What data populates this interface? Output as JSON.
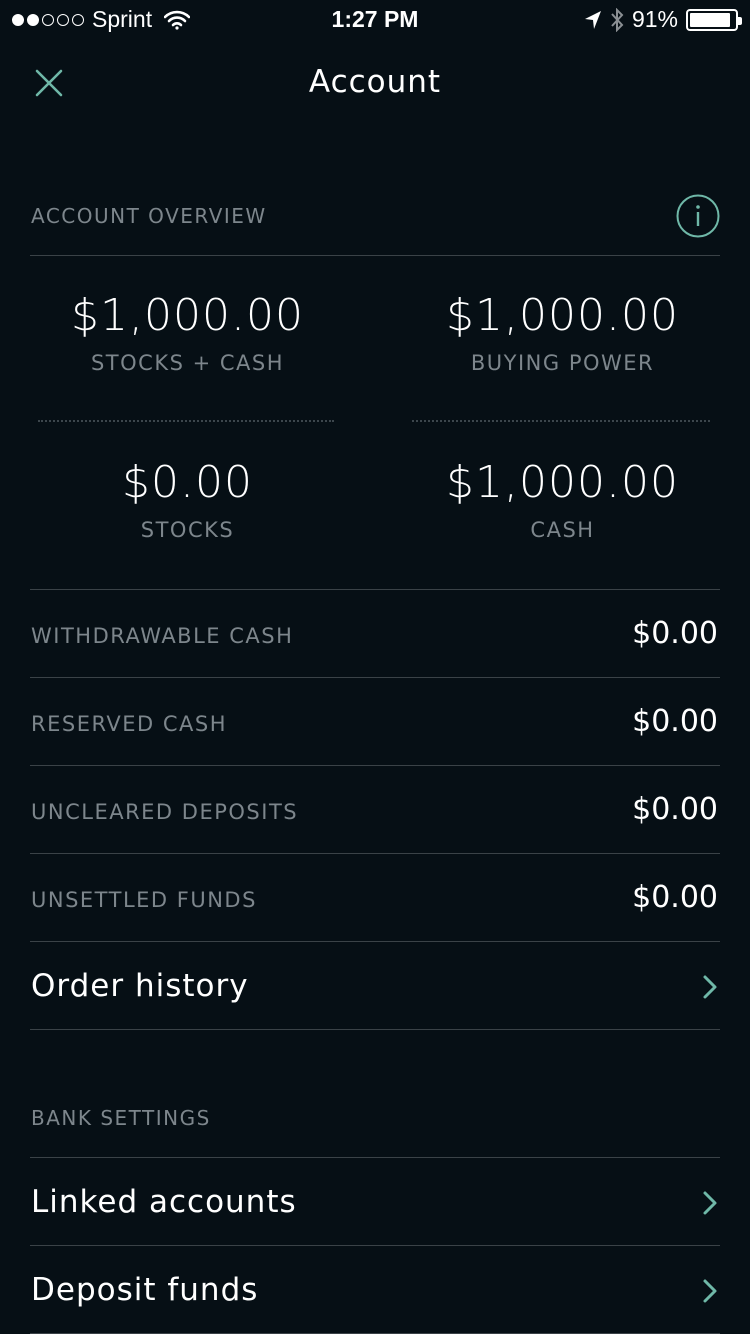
{
  "status_bar": {
    "carrier": "Sprint",
    "time": "1:27 PM",
    "battery": "91%",
    "battery_level": 0.91,
    "signal_bars_filled": 2,
    "signal_bars_total": 5
  },
  "nav": {
    "title": "Account",
    "close_icon": "close-icon"
  },
  "overview": {
    "header": "ACCOUNT OVERVIEW",
    "info_icon": "info-icon",
    "metrics": [
      {
        "value": "$1,000.00",
        "label": "STOCKS + CASH"
      },
      {
        "value": "$1,000.00",
        "label": "BUYING POWER"
      },
      {
        "value": "$0.00",
        "label": "STOCKS"
      },
      {
        "value": "$1,000.00",
        "label": "CASH"
      }
    ],
    "rows": [
      {
        "label": "WITHDRAWABLE CASH",
        "value": "$0.00"
      },
      {
        "label": "RESERVED CASH",
        "value": "$0.00"
      },
      {
        "label": "UNCLEARED DEPOSITS",
        "value": "$0.00"
      },
      {
        "label": "UNSETTLED FUNDS",
        "value": "$0.00"
      }
    ],
    "order_history": "Order history"
  },
  "bank": {
    "header": "BANK SETTINGS",
    "items": [
      {
        "label": "Linked accounts"
      },
      {
        "label": "Deposit funds"
      }
    ]
  },
  "colors": {
    "background": "#060f15",
    "accent": "#6fb8a8",
    "muted_text": "#7d868c",
    "divider": "#3a4247"
  }
}
